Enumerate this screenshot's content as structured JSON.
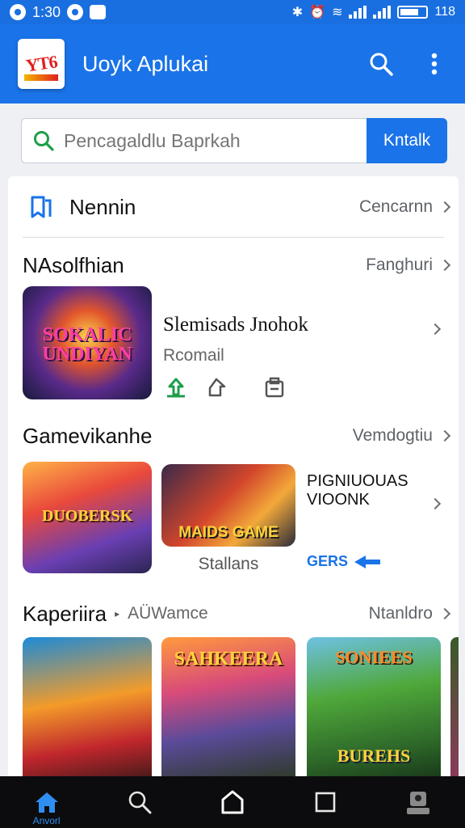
{
  "status_bar": {
    "time": "1:30",
    "battery": "118"
  },
  "app_bar": {
    "logo_text": "YT6",
    "title": "Uoyk Aplukai"
  },
  "search": {
    "placeholder": "Pencagaldlu Baprkah",
    "button_label": "Kntalk"
  },
  "nennin": {
    "title": "Nennin",
    "more": "Cencarnn"
  },
  "featured": {
    "title": "NAsolfhian",
    "more": "Fanghuri",
    "app": {
      "art_text": "SOKALIC UNDIYAN",
      "name": "Slemisads Jnohok",
      "subtitle": "Rcomail"
    }
  },
  "games": {
    "title": "Gamevikanhe",
    "more": "Vemdogtiu",
    "tiles": [
      {
        "art_text": "DUOBERSK",
        "caption": ""
      },
      {
        "art_text": "MAIDS GAME",
        "caption": "Stallans"
      }
    ],
    "side_text": "PIGNIUOUAS VIOONK",
    "side_link": "GERS"
  },
  "kaperiira": {
    "title": "Kaperiira",
    "subtitle": "AÜWamce",
    "more": "Ntanldro",
    "tiles": [
      {
        "art_text": ""
      },
      {
        "art_text": "SAHKEERA"
      },
      {
        "art_text": "SONIEES",
        "art_text_2": "BUREHS"
      }
    ]
  },
  "bottom_nav": {
    "home_label": "Anvorl"
  },
  "colors": {
    "primary": "#1a73e8",
    "status_bar": "#1a6fe0",
    "nav_bg": "#0c0c0e",
    "accent_green": "#1e9e4a"
  }
}
